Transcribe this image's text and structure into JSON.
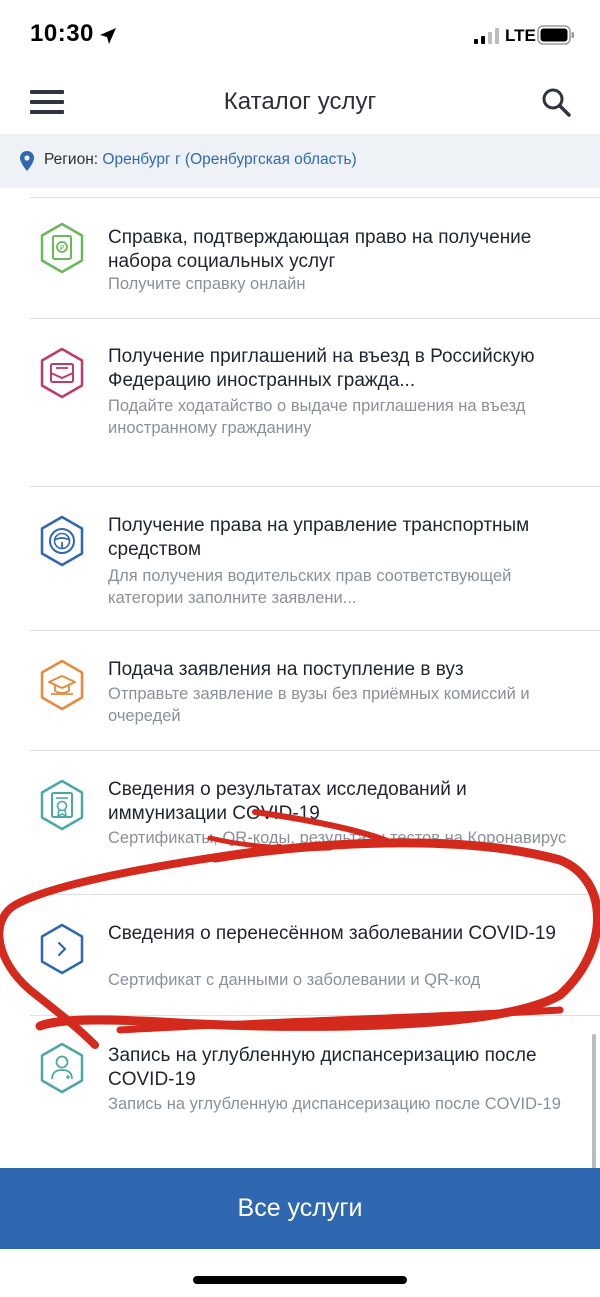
{
  "status_bar": {
    "time": "10:30",
    "network": "LTE"
  },
  "header": {
    "title": "Каталог услуг",
    "menu_icon": "hamburger-menu-icon",
    "search_icon": "search-icon"
  },
  "region": {
    "label": "Регион:",
    "value": "Оренбург г (Оренбургская область)"
  },
  "services": [
    {
      "title": "Справка, подтверждающая право на получение набора социальных услуг",
      "desc": "Получите справку онлайн",
      "icon": "certificate-document-icon",
      "color": "#6bb85a"
    },
    {
      "title": "Получение приглашений на въезд в Российскую Федерацию иностранных гражда...",
      "desc": "Подайте ходатайство о выдаче приглашения на въезд иностранному гражданину",
      "icon": "invitation-envelope-icon",
      "color": "#c0396b"
    },
    {
      "title": "Получение права на управление транспортным средством",
      "desc": "Для получения водительских прав соответствующей категории заполните заявлени...",
      "icon": "steering-wheel-icon",
      "color": "#2f67b0"
    },
    {
      "title": "Подача заявления на поступление в вуз",
      "desc": "Отправьте заявление в вузы без приёмных комиссий и очередей",
      "icon": "graduation-cap-icon",
      "color": "#e8883a"
    },
    {
      "title": "Сведения о результатах исследований и иммунизации COVID-19",
      "desc": "Сертификаты, QR-коды, результаты тестов на Коронавирус",
      "icon": "covid-certificate-icon",
      "color": "#4aa8a8"
    },
    {
      "title": "Сведения о перенесённом заболевании COVID-19",
      "desc": "Сертификат с данными о заболевании и QR-код",
      "icon": "chevron-right-icon",
      "color": "#2f67b0"
    },
    {
      "title": "Запись на углубленную диспансеризацию после COVID-19",
      "desc": "Запись на углубленную диспансеризацию после COVID-19",
      "icon": "doctor-icon",
      "color": "#4aa8a8"
    }
  ],
  "footer": {
    "all_services_label": "Все услуги"
  },
  "annotation_color": "#d42a1e"
}
